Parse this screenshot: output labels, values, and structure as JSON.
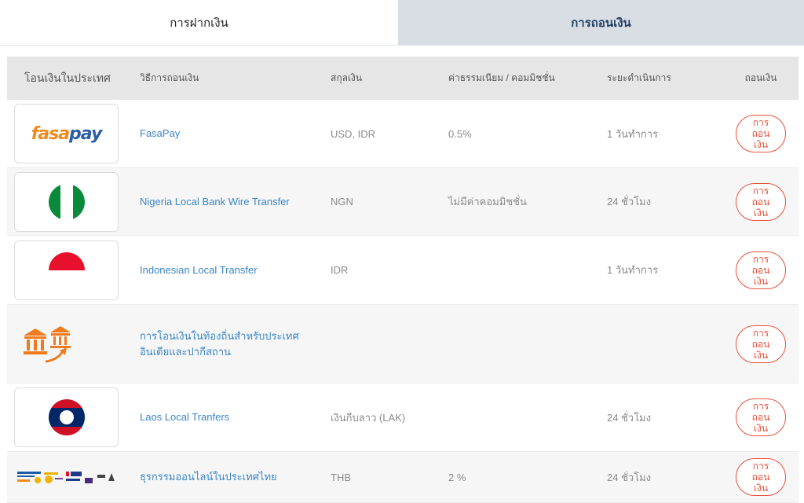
{
  "tabs": {
    "deposit": "การฝากเงิน",
    "withdraw": "การถอนเงิน"
  },
  "table": {
    "headers": {
      "logo": "โอนเงินในประเทศ",
      "method": "วิธีการถอนเงิน",
      "currency": "สกุลเงิน",
      "fee": "ค่าธรรมเนียม / คอมมิชชั่น",
      "time": "ระยะดำเนินการ",
      "action": "ถอนเงิน"
    },
    "rows": [
      {
        "logo_icon": "fasapay-logo",
        "logo_text_a": "fasa",
        "logo_text_b": "pay",
        "method": "FasaPay",
        "currency": "USD, IDR",
        "fee": "0.5%",
        "time": "1 วันทำการ",
        "action": "การถอนเงิน"
      },
      {
        "logo_icon": "nigeria-flag-icon",
        "method": "Nigeria Local Bank Wire Transfer",
        "currency": "NGN",
        "fee": "ไม่มีค่าคอมมิชชั่น",
        "time": "24 ชั่วโมง",
        "action": "การถอนเงิน"
      },
      {
        "logo_icon": "indonesia-flag-icon",
        "method": "Indonesian Local Transfer",
        "currency": "IDR",
        "fee": "",
        "time": "1 วันทำการ",
        "action": "การถอนเงิน"
      },
      {
        "logo_icon": "bank-transfer-icon",
        "method_line1": "การโอนเงินในท้องถิ่นสำหรับประเทศ",
        "method_line2": "อินเดียและปากีสถาน",
        "currency": "",
        "fee": "",
        "time": "",
        "action": "การถอนเงิน"
      },
      {
        "logo_icon": "laos-flag-icon",
        "method": "Laos Local Tranfers",
        "currency": "เงินกีบลาว (LAK)",
        "fee": "",
        "time": "24 ชั่วโมง",
        "action": "การถอนเงิน"
      },
      {
        "logo_icon": "thai-banks-logos",
        "method": "ธุรกรรมออนไลน์ในประเทศไทย",
        "currency": "THB",
        "fee": "2 %",
        "time": "24 ชั่วโมง",
        "action": "การถอนเงิน"
      }
    ]
  },
  "colors": {
    "accent": "#e8503a",
    "link": "#3a86c8",
    "active_tab_bg": "#d9dee5",
    "header_bg": "#e6e6e6"
  }
}
